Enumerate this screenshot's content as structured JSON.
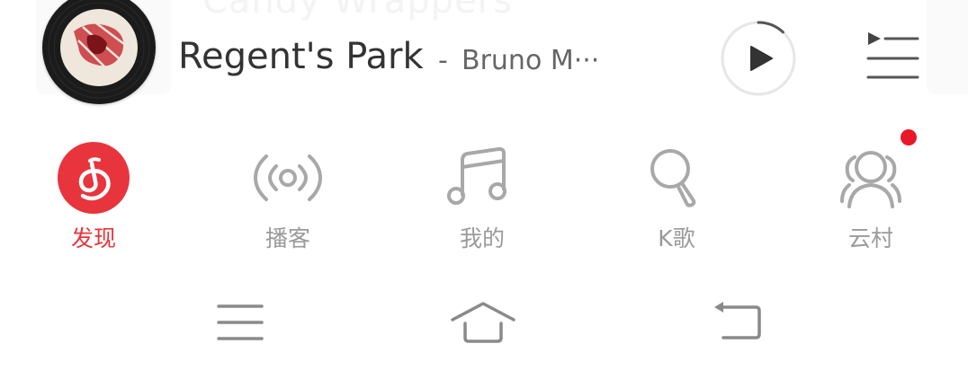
{
  "background_text": "Candy Wrappers",
  "player": {
    "title": "Regent's Park",
    "separator": "-",
    "artist": "Bruno M···",
    "play_icon": "play-icon",
    "playlist_icon": "playlist-icon",
    "progress_fraction": 0.12
  },
  "tabs": [
    {
      "label": "发现",
      "icon": "discover-icon",
      "active": true
    },
    {
      "label": "播客",
      "icon": "podcast-icon",
      "active": false
    },
    {
      "label": "我的",
      "icon": "music-note-icon",
      "active": false
    },
    {
      "label": "K歌",
      "icon": "microphone-icon",
      "active": false
    },
    {
      "label": "云村",
      "icon": "people-icon",
      "active": false,
      "has_badge": true
    }
  ],
  "colors": {
    "accent": "#e8343c",
    "badge": "#e8182a",
    "inactive": "#9a9a9a",
    "title_text": "#333333"
  },
  "system_nav": [
    "menu-icon",
    "home-icon",
    "back-icon"
  ]
}
